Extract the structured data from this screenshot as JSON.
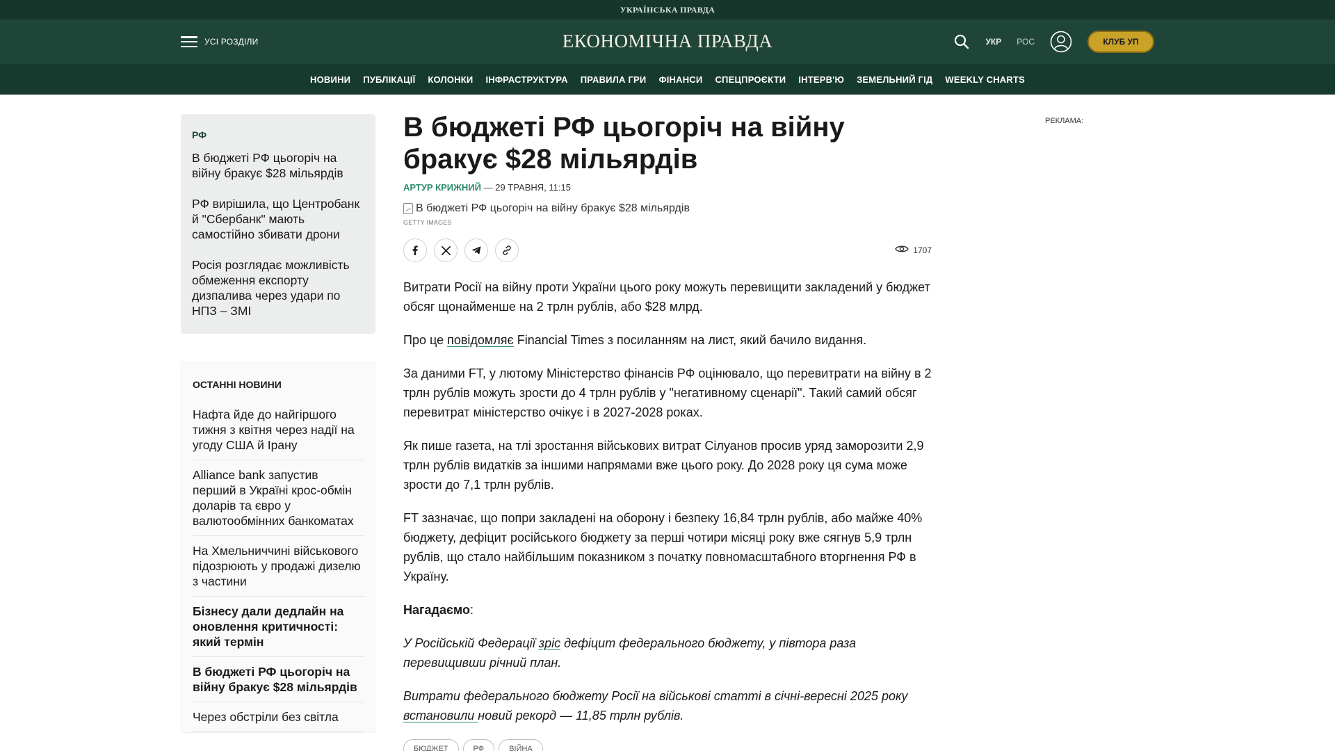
{
  "top_strip": {
    "text": "УКРАЇНСЬКА ПРАВДА"
  },
  "header": {
    "menu_label": "УСІ РОЗДІЛИ",
    "logo": "ЕКОНОМІЧНА ПРАВДА",
    "lang_ukr": "УКР",
    "lang_ros": "РОС",
    "club_label": "КЛУБ УП",
    "icons": [
      "menu-icon",
      "search-icon",
      "user-icon"
    ]
  },
  "nav": {
    "items": [
      "НОВИНИ",
      "ПУБЛІКАЦІЇ",
      "КОЛОНКИ",
      "ІНФРАСТРУКТУРА",
      "ПРАВИЛА ГРИ",
      "ФІНАНСИ",
      "СПЕЦПРОЄКТИ",
      "ІНТЕРВ'Ю",
      "ЗЕМЕЛЬНИЙ ГІД",
      "WEEKLY CHARTS"
    ]
  },
  "sidebar": {
    "related_head": "РФ",
    "related": [
      "В бюджеті РФ цьогоріч на війну бракує $28 мільярдів",
      "РФ вирішила, що Центробанк й \"Сбербанк\" мають самостійно збивати дрони",
      "Росія розглядає можливість обмеження експорту дизпалива через удари по НПЗ – ЗМІ"
    ],
    "latest_head": "ОСТАННІ НОВИНИ",
    "latest": [
      "Нафта йде до найгіршого тижня з квітня через надії на угоду США й Ірану",
      "Alliance bank запустив перший в Україні крос-обмін доларів та євро у валютообмінних банкоматах",
      "На Хмельниччині військового підозрюють у продажі дизелю з частини",
      "Бізнесу дали дедлайн на оновлення критичності: який термін",
      "В бюджеті РФ цьогоріч на війну бракує $28 мільярдів",
      "Через обстріли без світла"
    ]
  },
  "article": {
    "title": "В бюджеті РФ цьогоріч на війну бракує $28 мільярдів",
    "author": "АРТУР КРИЖНИЙ",
    "date": " — 29 ТРАВНЯ, 11:15",
    "photo_alt": "В бюджеті РФ цьогоріч на війну бракує $28 мільярдів",
    "photo_credit": "GETTY IMAGES",
    "views": "1707",
    "share_icons": [
      "facebook-icon",
      "x-icon",
      "telegram-icon",
      "link-icon"
    ],
    "p1": "Витрати Росії на війну проти України цього року можуть перевищити закладений у бюджет обсяг щонайменше на 2 трлн рублів, або $28 млрд.",
    "p2_pre": "Про це ",
    "p2_link": "повідомляє",
    "p2_post": " Financial Times з посиланням на лист, який бачило видання.",
    "p3": "За даними FT, у лютому Міністерство фінансів РФ оцінювало, що перевитрати на війну в 2 трлн рублів можуть зрости до 4 трлн рублів у \"негативному сценарії\". Такий самий обсяг перевитрат міністерство очікує і в 2027-2028 роках.",
    "p4": "Як пише газета, на тлі зростання військових витрат Сілуанов просив уряд заморозити 2,9 трлн рублів видатків за іншими напрямами вже цього року. До 2028 року ця сума може зрости до 7,1 трлн рублів.",
    "p5": "FT зазначає, що попри закладені на оборону і безпеку 16,84 трлн рублів, або майже 40% бюджету, дефіцит російського бюджету за перші чотири місяці року вже сягнув 5,9 трлн рублів, що стало найбільшим показником з початку повномасштабного вторгнення РФ в Україну.",
    "reminder": "Нагадаємо",
    "reminder_colon": ":",
    "p6_pre": "У Російській Федерації ",
    "p6_link": "зріс",
    "p6_post": " дефіцит федерального бюджету, у півтора раза перевищивши річний план.",
    "p7_pre": "Витрати федерального бюджету Росії на військові статті в січні-вересні 2025 року ",
    "p7_link": "встановили ",
    "p7_post": "новий рекорд — 11,85 трлн рублів.",
    "tags": [
      "БЮДЖЕТ",
      "РФ",
      "ВІЙНА"
    ]
  },
  "ad": {
    "label": "РЕКЛАМА:"
  },
  "colors": {
    "header_bg": "#1f4538",
    "nav_bg": "#173a2f",
    "accent": "#2c8a6a",
    "club": "#c9a227"
  }
}
